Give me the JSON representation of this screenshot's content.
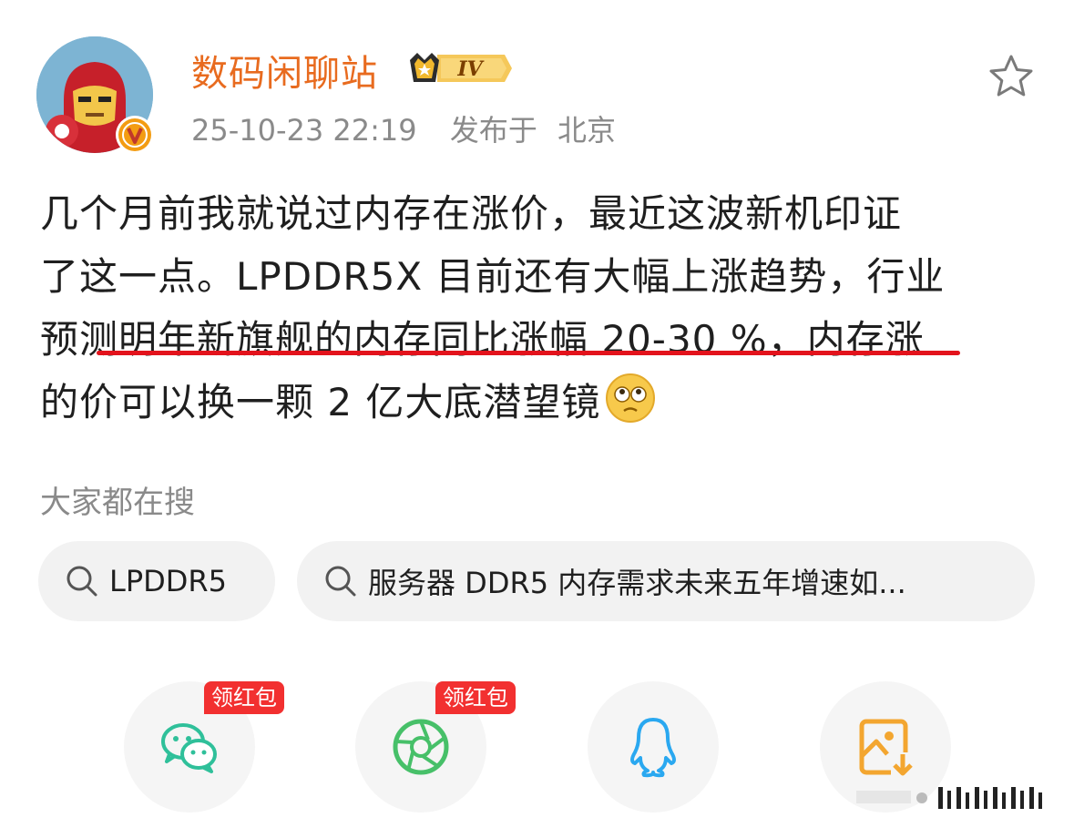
{
  "post": {
    "username": "数码闲聊站",
    "rank_badge": "IV",
    "timestamp": "25-10-23 22:19",
    "location_prefix": "发布于",
    "location": "北京",
    "text_lines": [
      "几个月前我就说过内存在涨价，最近这波新机印证",
      "了这一点。LPDDR5X 目前还有大幅上涨趋势，行业",
      "预测明年新旗舰的内存同比涨幅 20-30 %，内存涨",
      "的价可以换一颗 2 亿大底潜望镜"
    ],
    "emoji": "tired-face-emoji"
  },
  "search": {
    "title": "大家都在搜",
    "chips": [
      "LPDDR5",
      "服务器 DDR5 内存需求未来五年增速如..."
    ]
  },
  "share": {
    "tag_label": "领红包",
    "items": [
      "wechat-icon",
      "moments-icon",
      "qq-icon",
      "save-image-icon"
    ]
  },
  "colors": {
    "username": "#e86b1f",
    "underline": "#e3131c",
    "red_tag": "#f23030",
    "wechat": "#2fc09a",
    "moments": "#47c069",
    "qq": "#2aa8f0",
    "save": "#f3a630"
  }
}
